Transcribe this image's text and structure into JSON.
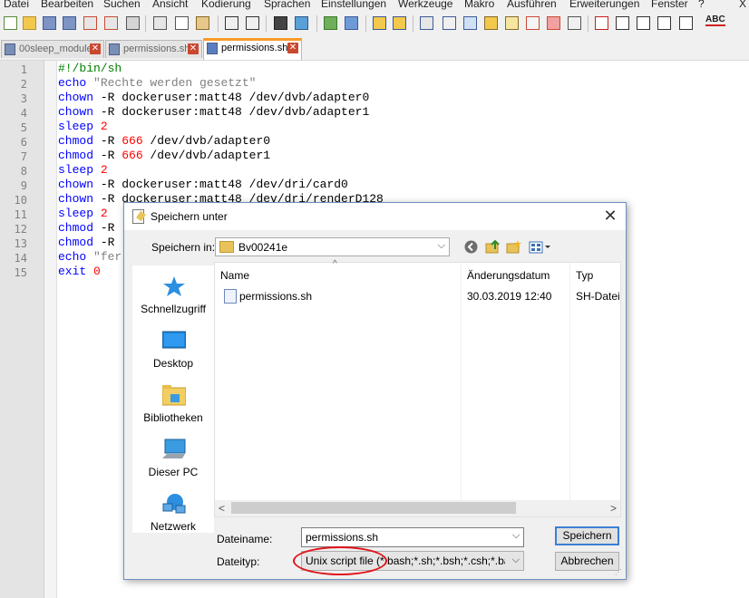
{
  "menu": [
    "Datei",
    "Bearbeiten",
    "Suchen",
    "Ansicht",
    "Kodierung",
    "Sprachen",
    "Einstellungen",
    "Werkzeuge",
    "Makro",
    "Ausführen",
    "Erweiterungen",
    "Fenster",
    "?",
    "X"
  ],
  "tabs": [
    {
      "label": "00sleep_module",
      "close": "✕"
    },
    {
      "label": "permissions.sh",
      "close": "✕"
    },
    {
      "label": "permissions.sh",
      "close": "✕"
    }
  ],
  "toolbar": {
    "abc_label": "ABC"
  },
  "editor": {
    "line_numbers": [
      "1",
      "2",
      "3",
      "4",
      "5",
      "6",
      "7",
      "8",
      "9",
      "10",
      "11",
      "12",
      "13",
      "14",
      "15"
    ],
    "lines": [
      [
        {
          "t": "#!/bin/sh",
          "c": "cmt"
        }
      ],
      [
        {
          "t": "echo ",
          "c": "kw"
        },
        {
          "t": "\"Rechte werden gesetzt\"",
          "c": "str"
        }
      ],
      [
        {
          "t": "chown ",
          "c": "kw"
        },
        {
          "t": "-R dockeruser:matt48 /dev/dvb/adapter0",
          "c": ""
        }
      ],
      [
        {
          "t": "chown ",
          "c": "kw"
        },
        {
          "t": "-R dockeruser:matt48 /dev/dvb/adapter1",
          "c": ""
        }
      ],
      [
        {
          "t": "sleep ",
          "c": "kw"
        },
        {
          "t": "2",
          "c": "num"
        }
      ],
      [
        {
          "t": "chmod ",
          "c": "kw"
        },
        {
          "t": "-R ",
          "c": ""
        },
        {
          "t": "666",
          "c": "num"
        },
        {
          "t": " /dev/dvb/adapter0",
          "c": ""
        }
      ],
      [
        {
          "t": "chmod ",
          "c": "kw"
        },
        {
          "t": "-R ",
          "c": ""
        },
        {
          "t": "666",
          "c": "num"
        },
        {
          "t": " /dev/dvb/adapter1",
          "c": ""
        }
      ],
      [
        {
          "t": "sleep ",
          "c": "kw"
        },
        {
          "t": "2",
          "c": "num"
        }
      ],
      [
        {
          "t": "chown ",
          "c": "kw"
        },
        {
          "t": "-R dockeruser:matt48 /dev/dri/card0",
          "c": ""
        }
      ],
      [
        {
          "t": "chown ",
          "c": "kw"
        },
        {
          "t": "-R dockeruser:matt48 /dev/dri/renderD128",
          "c": ""
        }
      ],
      [
        {
          "t": "sleep ",
          "c": "kw"
        },
        {
          "t": "2",
          "c": "num"
        }
      ],
      [
        {
          "t": "chmod ",
          "c": "kw"
        },
        {
          "t": "-R",
          "c": ""
        }
      ],
      [
        {
          "t": "chmod ",
          "c": "kw"
        },
        {
          "t": "-R",
          "c": ""
        }
      ],
      [
        {
          "t": "echo ",
          "c": "kw"
        },
        {
          "t": "\"fer",
          "c": "str"
        }
      ],
      [
        {
          "t": "exit ",
          "c": "kw"
        },
        {
          "t": "0",
          "c": "num"
        }
      ]
    ]
  },
  "dialog": {
    "title": "Speichern unter",
    "close": "✕",
    "save_in_label": "Speichern in:",
    "save_in_value": "Bv00241e",
    "places": [
      "Schnellzugriff",
      "Desktop",
      "Bibliotheken",
      "Dieser PC",
      "Netzwerk"
    ],
    "columns": {
      "name": "Name",
      "date": "Änderungsdatum",
      "type": "Typ"
    },
    "files": [
      {
        "name": "permissions.sh",
        "date": "30.03.2019 12:40",
        "type": "SH-Datei"
      }
    ],
    "filename_label": "Dateiname:",
    "filename_value": "permissions.sh",
    "filetype_label": "Dateityp:",
    "filetype_value": "Unix script file (*.bash;*.sh;*.bsh;*.csh;*.bash_pr",
    "save_button": "Speichern",
    "cancel_button": "Abbrechen"
  },
  "colors": {
    "keyword": "#0000ff",
    "number": "#ff0000",
    "string": "#808080",
    "comment": "#008000",
    "active_tab_accent": "#fa9a28",
    "annotation": "#e0141b"
  }
}
